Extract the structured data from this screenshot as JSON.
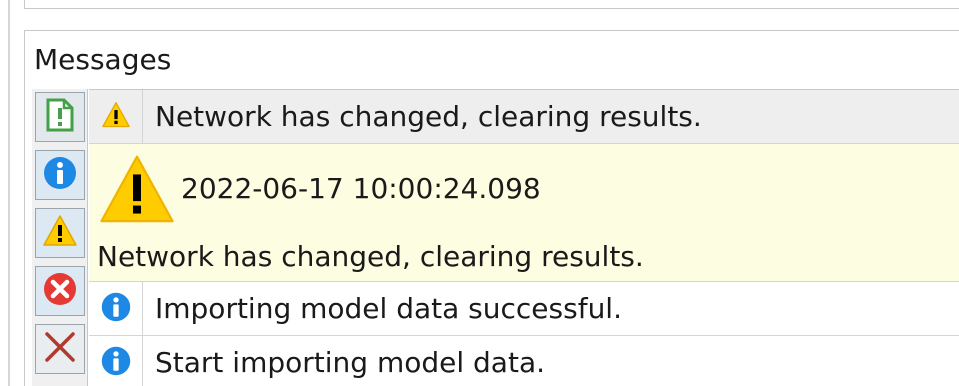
{
  "panel": {
    "title": "Messages"
  },
  "filters": [
    {
      "name": "filter-all",
      "icon": "message-list-icon"
    },
    {
      "name": "filter-info",
      "icon": "info-icon"
    },
    {
      "name": "filter-warning",
      "icon": "warning-icon"
    },
    {
      "name": "filter-error",
      "icon": "error-icon"
    },
    {
      "name": "filter-clear",
      "icon": "clear-x-icon"
    }
  ],
  "messages": [
    {
      "level": "warning",
      "text": "Network has changed, clearing results.",
      "selected": true
    },
    {
      "level": "info",
      "text": "Importing model data successful."
    },
    {
      "level": "info",
      "text": "Start importing model data."
    }
  ],
  "detail": {
    "timestamp": "2022-06-17 10:00:24.098",
    "text": "Network has changed, clearing results."
  },
  "colors": {
    "warning": "#ffcc00",
    "info": "#1e88e5",
    "error": "#e53935",
    "detail_bg": "#fdfde2",
    "accent_green": "#43a047",
    "clear_red": "#b03a2e"
  }
}
